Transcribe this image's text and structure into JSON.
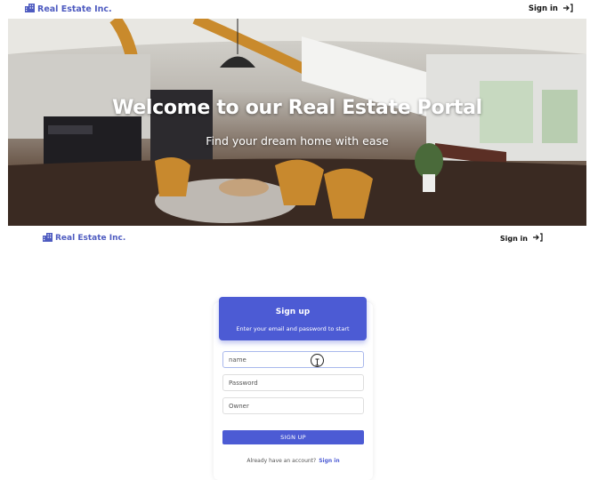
{
  "brand": {
    "name": "Real Estate Inc.",
    "icon": "building-icon",
    "color": "#4e5bc0"
  },
  "nav": {
    "signin_label": "Sign in",
    "signin_icon": "sign-in-arrow-icon"
  },
  "hero": {
    "title": "Welcome to our Real Estate Portal",
    "subtitle": "Find your dream home with ease"
  },
  "signup": {
    "title": "Sign up",
    "subtitle": "Enter your email and password to start",
    "fields": [
      {
        "placeholder": "name",
        "focused": true
      },
      {
        "placeholder": "Password"
      },
      {
        "placeholder": "Owner"
      }
    ],
    "button_label": "SIGN UP",
    "footer_text": "Already have an account?",
    "footer_link": "Sign in",
    "accent_color": "#4c5bd4"
  }
}
